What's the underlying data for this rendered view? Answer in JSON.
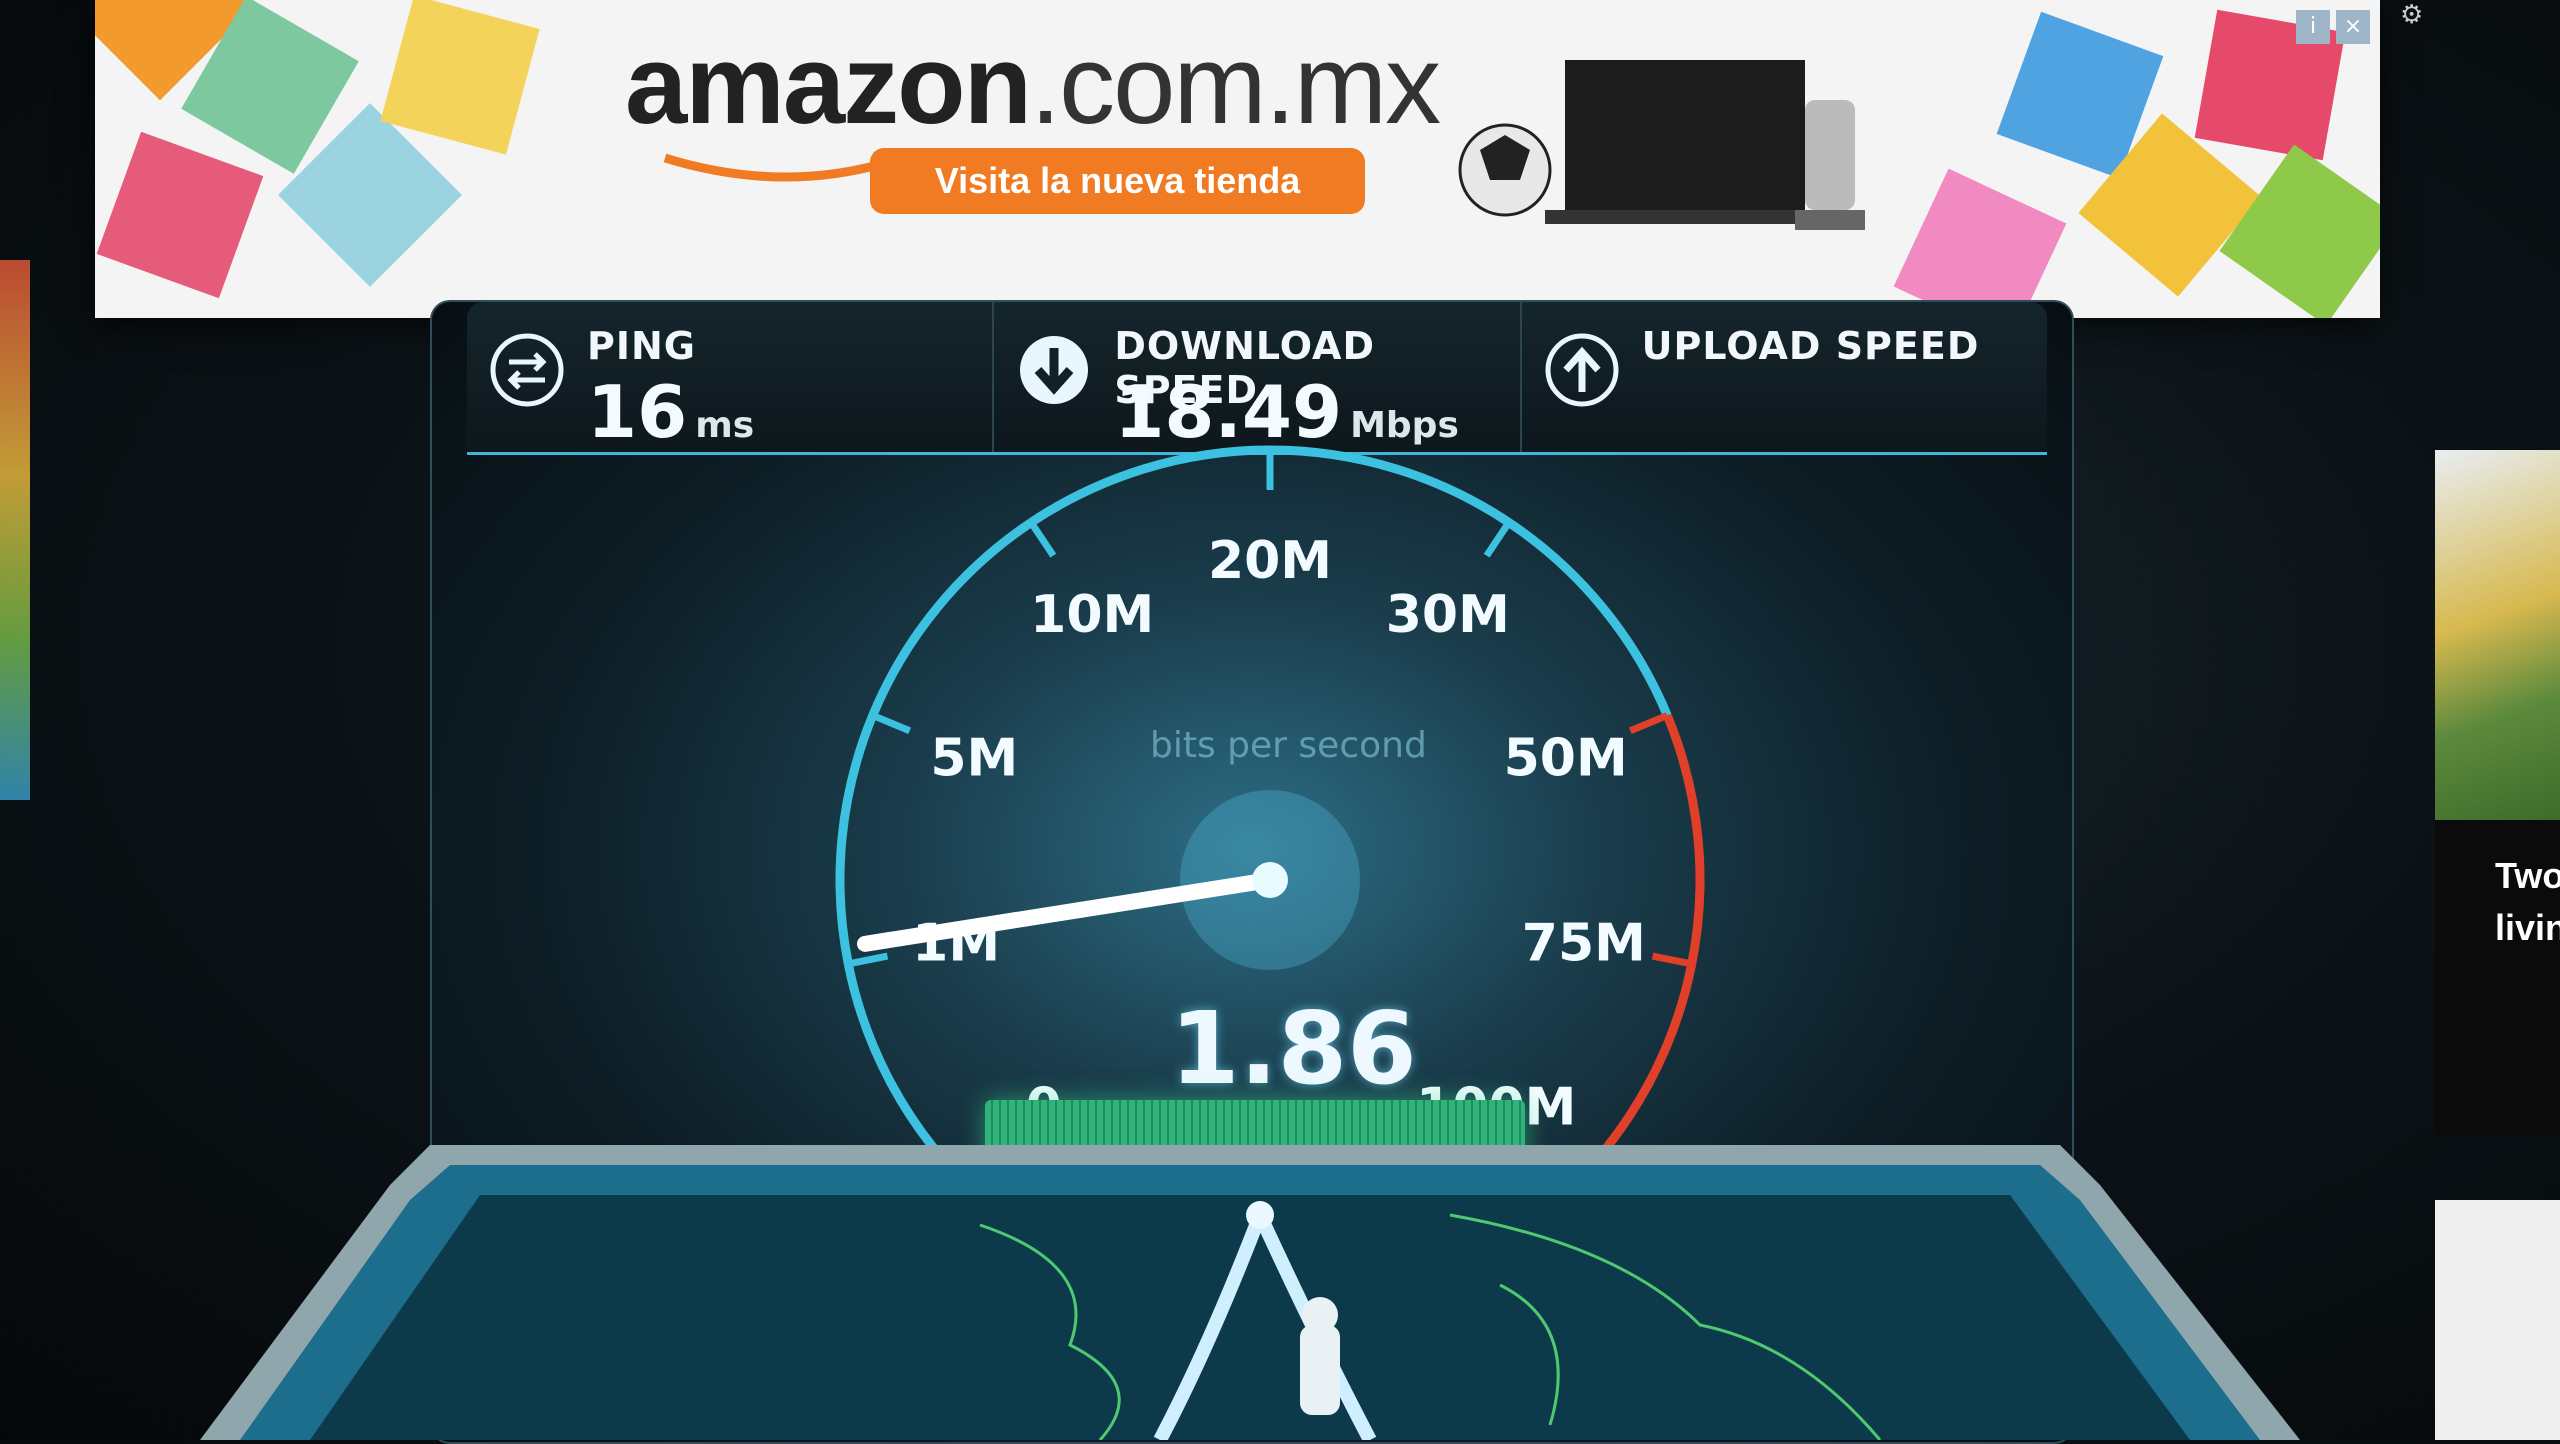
{
  "ad": {
    "logo_text": "amazon",
    "logo_tld": ".com.mx",
    "cta_label": "Visita la nueva tienda"
  },
  "stats": {
    "ping": {
      "label": "PING",
      "value": "16",
      "unit": "ms",
      "icon": "ping-icon"
    },
    "download": {
      "label": "DOWNLOAD SPEED",
      "value": "18.49",
      "unit": "Mbps",
      "icon": "download-arrow-icon"
    },
    "upload": {
      "label": "UPLOAD SPEED",
      "value": "",
      "unit": "",
      "icon": "upload-arrow-icon"
    }
  },
  "gauge": {
    "caption": "bits per second",
    "current_reading": "1.86",
    "ticks": [
      "0",
      "1M",
      "5M",
      "10M",
      "20M",
      "30M",
      "50M",
      "75M",
      "100M"
    ],
    "needle_at_tick": "1M",
    "colors": {
      "arc": "#3cc2e0",
      "redline": "#e0402a",
      "needle": "#ffffff"
    }
  },
  "side_ad": {
    "text_line1": "Two",
    "text_line2": "livin"
  },
  "colors": {
    "accent": "#3fb7d8",
    "cta": "#f07b22"
  }
}
